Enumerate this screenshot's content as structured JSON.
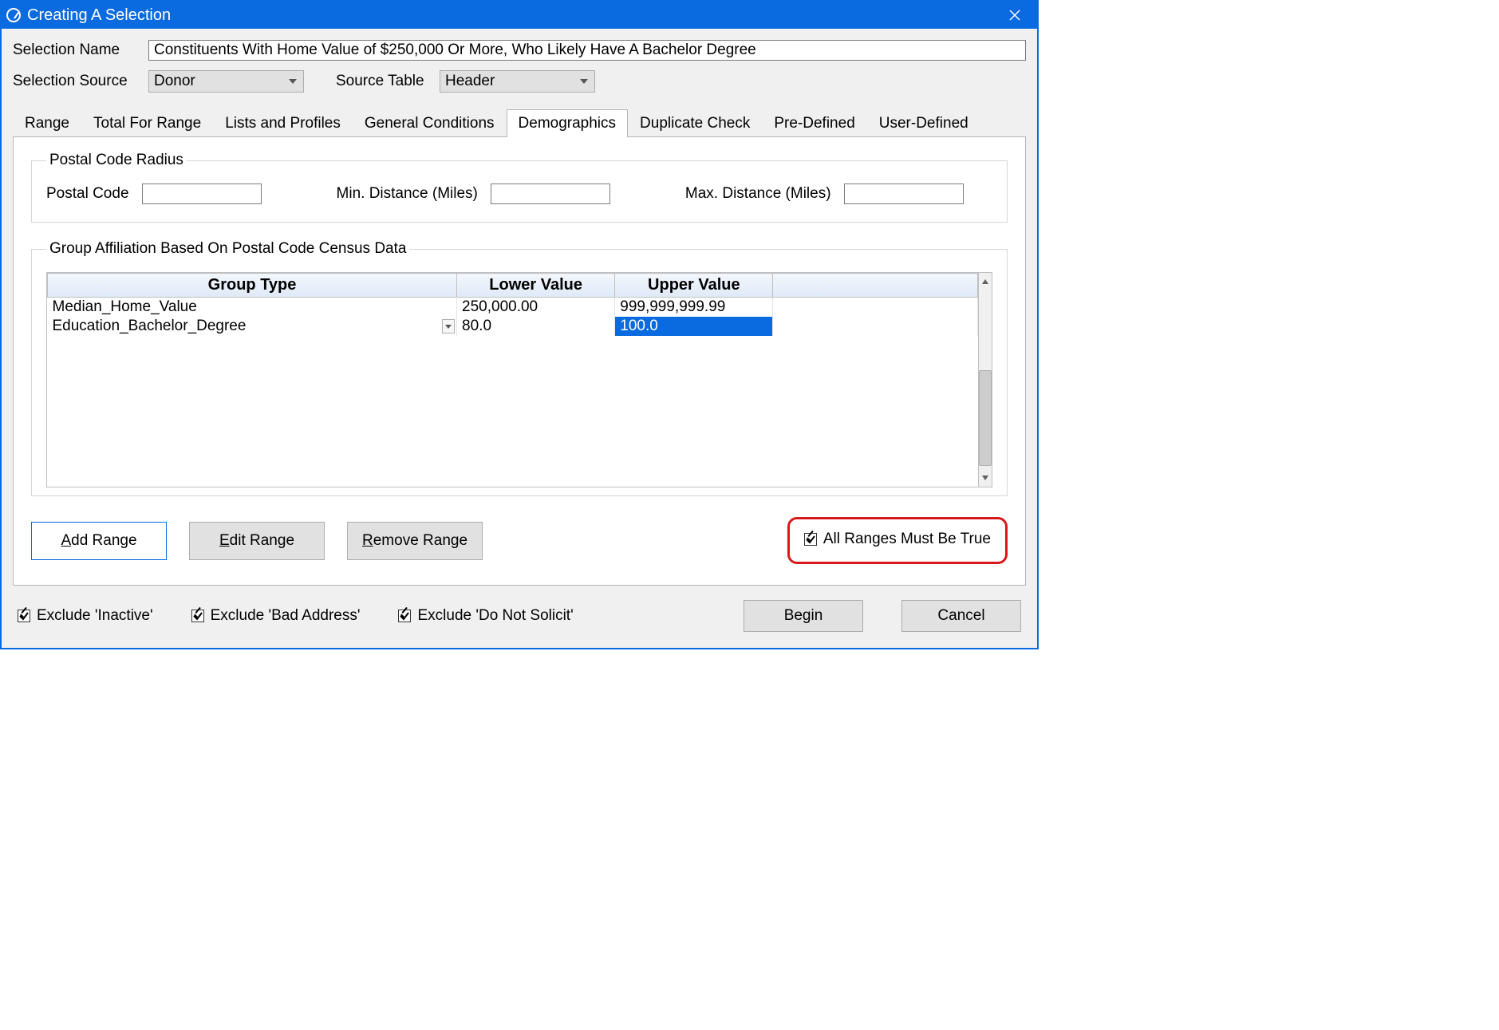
{
  "window": {
    "title": "Creating A Selection"
  },
  "labels": {
    "selection_name": "Selection Name",
    "selection_source": "Selection Source",
    "source_table": "Source Table"
  },
  "values": {
    "selection_name": "Constituents With Home Value of $250,000 Or More, Who Likely Have A Bachelor Degree",
    "selection_source": "Donor",
    "source_table": "Header"
  },
  "tabs": [
    "Range",
    "Total For Range",
    "Lists and Profiles",
    "General Conditions",
    "Demographics",
    "Duplicate Check",
    "Pre-Defined",
    "User-Defined"
  ],
  "active_tab": "Demographics",
  "postal": {
    "legend": "Postal Code Radius",
    "postal_code_lbl": "Postal Code",
    "min_lbl": "Min. Distance (Miles)",
    "max_lbl": "Max. Distance (Miles)",
    "postal_code": "",
    "min": "",
    "max": ""
  },
  "census": {
    "legend": "Group Affiliation Based On Postal Code Census Data",
    "headers": {
      "group_type": "Group Type",
      "lower": "Lower Value",
      "upper": "Upper Value"
    },
    "rows": [
      {
        "group_type": "Median_Home_Value",
        "lower": "250,000.00",
        "upper": "999,999,999.99",
        "editing": false,
        "sel_upper": false
      },
      {
        "group_type": "Education_Bachelor_Degree",
        "lower": "80.0",
        "upper": "100.0",
        "editing": true,
        "sel_upper": true
      }
    ]
  },
  "buttons": {
    "add_range": "Add Range",
    "edit_range": "Edit Range",
    "remove_range": "Remove Range",
    "all_true": "All Ranges Must Be True",
    "begin": "Begin",
    "cancel": "Cancel"
  },
  "footer_checks": {
    "exclude_inactive": "Exclude 'Inactive'",
    "exclude_bad_address": "Exclude 'Bad Address'",
    "exclude_dns": "Exclude 'Do Not Solicit'"
  },
  "checkbox_states": {
    "all_true": true,
    "exclude_inactive": true,
    "exclude_bad_address": true,
    "exclude_dns": true
  }
}
